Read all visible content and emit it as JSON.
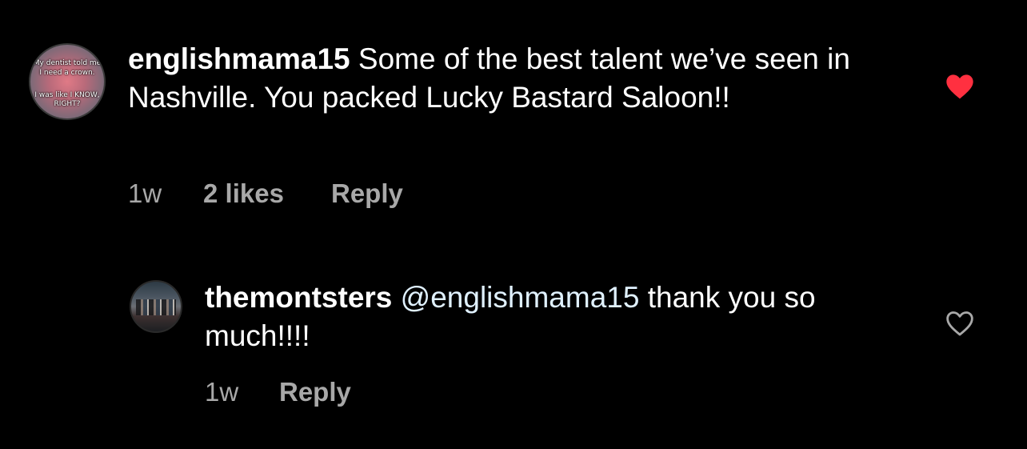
{
  "colors": {
    "background": "#000000",
    "text": "#ffffff",
    "meta_text": "#a8a8a8",
    "mention": "#e0f1ff",
    "liked_heart": "#ff3040",
    "unliked_heart": "#a8a8a8"
  },
  "comments": [
    {
      "avatar_caption": [
        "My dentist told me",
        "I need a crown.",
        "I was like I KNOW,",
        "RIGHT?"
      ],
      "username": "englishmama15",
      "text": "Some of the best talent we’ve seen in Nashville. You packed Lucky Bastard Saloon!!",
      "time": "1w",
      "likes": "2 likes",
      "reply_label": "Reply",
      "liked": true,
      "like_icon": "heart-filled-icon"
    },
    {
      "username": "themontsters",
      "mention": "@englishmama15",
      "text": "thank you so much!!!!",
      "time": "1w",
      "reply_label": "Reply",
      "liked": false,
      "like_icon": "heart-outline-icon"
    }
  ]
}
